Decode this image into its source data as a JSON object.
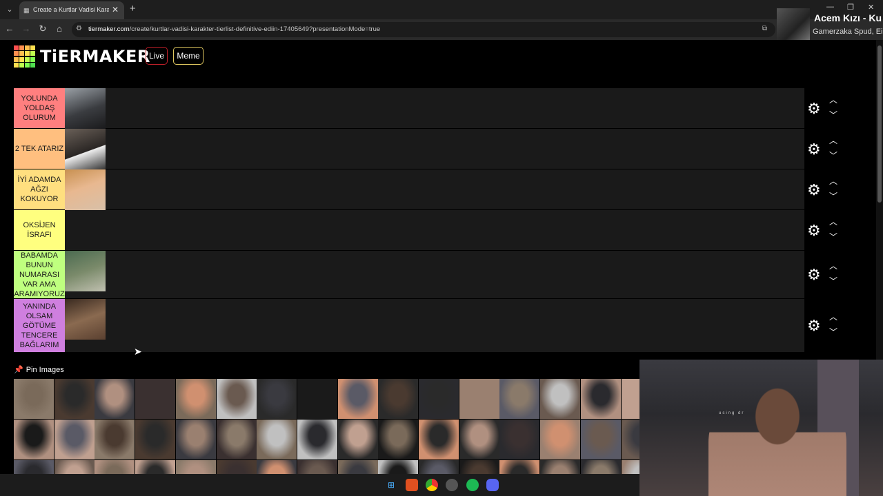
{
  "browser": {
    "tab_title": "Create a Kurtlar Vadisi Karakter",
    "tab_close": "✕",
    "new_tab": "+",
    "url_domain": "tiermaker.com",
    "url_path": "/create/kurtlar-vadisi-karakter-tierlist-definitive-ediin-17405649?presentationMode=true"
  },
  "now_playing": {
    "song": "Acem Kızı - Ku",
    "artist": "Gamerzaka Spud, Ei"
  },
  "header": {
    "logo": "TiERMAKER",
    "live_label": "Live",
    "meme_label": "Meme"
  },
  "tiers": [
    {
      "label": "YOLUNDA YOLDAŞ OLURUM",
      "color": "#ff7f7f",
      "items": 1
    },
    {
      "label": "2 TEK ATARIZ",
      "color": "#ffbf7f",
      "items": 1
    },
    {
      "label": "İYİ ADAMDA AĞZI KOKUYOR",
      "color": "#ffdf7f",
      "items": 1
    },
    {
      "label": "OKSİJEN İSRAFI",
      "color": "#ffff7f",
      "items": 0
    },
    {
      "label": "BABAMDA BUNUN NUMARASI VAR AMA ARAMIYORUZ",
      "color": "#bfff7f",
      "items": 1
    },
    {
      "label": "YANINDA OLSAM GÖTÜME TENCERE BAĞLARIM",
      "color": "#cf7fdf",
      "items": 1
    }
  ],
  "pin_images_label": "Pin Images",
  "webcam_overlay_text": "using dr",
  "icons": {
    "gear": "gear-icon",
    "up": "chevron-up-icon",
    "down": "chevron-down-icon",
    "pin": "pin-icon"
  }
}
